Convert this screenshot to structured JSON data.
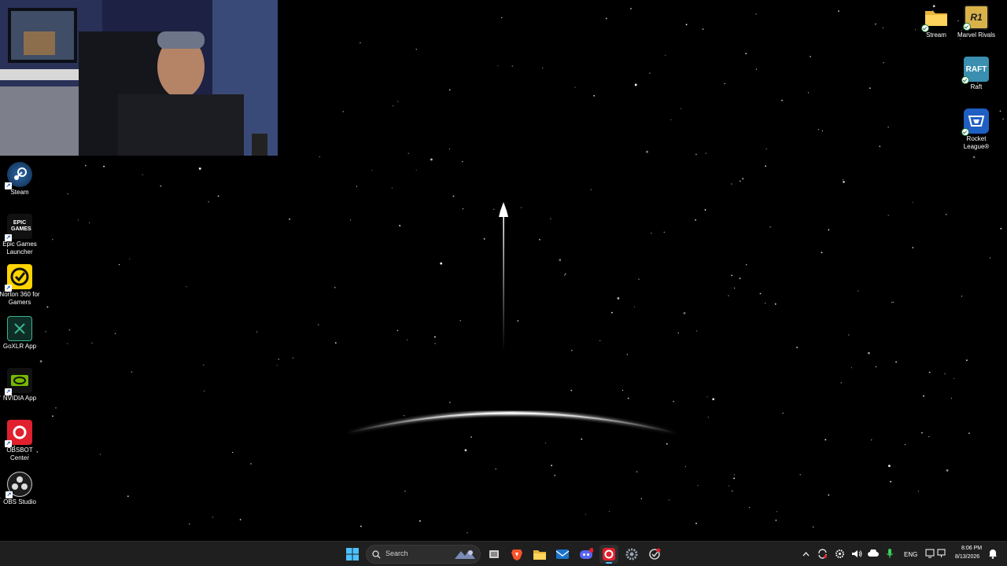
{
  "desktop": {
    "left_icons": [
      {
        "label": "Steam",
        "icon": "steam-icon"
      },
      {
        "label": "Epic Games Launcher",
        "icon": "epic-games-icon",
        "logo_text": "EPIC GAMES"
      },
      {
        "label": "Norton 360 for Gamers",
        "icon": "norton-icon"
      },
      {
        "label": "GoXLR App",
        "icon": "goxlr-icon"
      },
      {
        "label": "NVIDIA App",
        "icon": "nvidia-icon"
      },
      {
        "label": "OBSBOT Center",
        "icon": "obsbot-icon"
      },
      {
        "label": "OBS Studio",
        "icon": "obs-icon"
      }
    ],
    "right_icons": [
      {
        "label": "Stream",
        "icon": "folder-icon"
      },
      {
        "label": "Marvel Rivals",
        "icon": "marvel-rivals-icon",
        "logo_text": "R1"
      },
      {
        "label": "Raft",
        "icon": "raft-icon",
        "logo_text": "RAFT"
      },
      {
        "label": "Rocket League®",
        "icon": "rocket-league-icon"
      }
    ],
    "wallpaper": "rocket-launch-over-horizon"
  },
  "taskbar": {
    "search_placeholder": "Search",
    "pinned": [
      "start-icon",
      "search-icon",
      "task-view-icon",
      "brave-icon",
      "file-explorer-icon",
      "outlook-icon",
      "discord-icon",
      "obsbot-icon",
      "settings-icon",
      "norton-icon"
    ],
    "tray": {
      "language": "ENG",
      "time": "8:06 PM",
      "date": "8/13/2026"
    }
  },
  "colors": {
    "taskbar_bg": "#1f1f1f",
    "accent": "#4cc2ff",
    "desktop_bg": "#000000"
  }
}
